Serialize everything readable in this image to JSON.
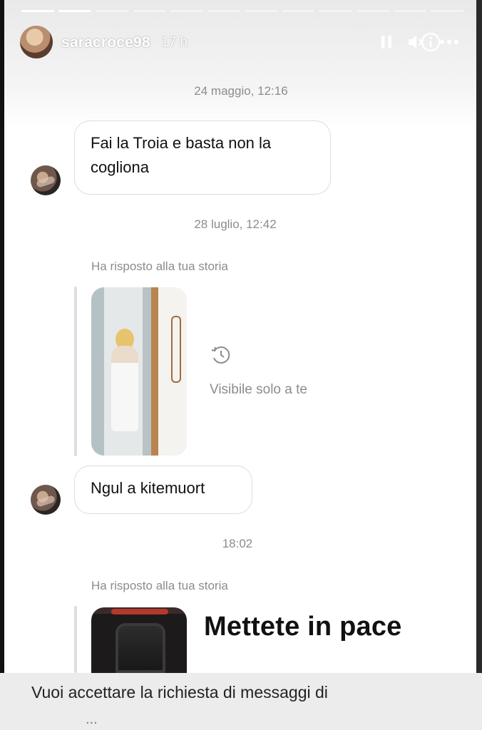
{
  "header": {
    "username": "saracroce98",
    "time_ago": "17 h"
  },
  "icons": {
    "pause": "pause-icon",
    "mute": "mute-icon",
    "info": "info-icon",
    "more": "more-icon"
  },
  "messages": {
    "ts1": "24 maggio, 12:16",
    "bubble1": "Fai la Troia e basta non la cogliona",
    "ts2": "28 luglio, 12:42",
    "reply_caption1": "Ha risposto alla tua storia",
    "visible_only": "Visibile solo a te",
    "bubble2": "Ngul a kitemuort",
    "ts3": "18:02",
    "reply_caption2": "Ha risposto alla tua storia",
    "story_text": "Mettete in pace"
  },
  "footer": {
    "request_text": "Vuoi accettare la richiesta di messaggi di ",
    "request_text_cut": "..."
  },
  "colors": {
    "accent_ring": "#d92d7a",
    "muted_text": "#8c8c8c"
  }
}
